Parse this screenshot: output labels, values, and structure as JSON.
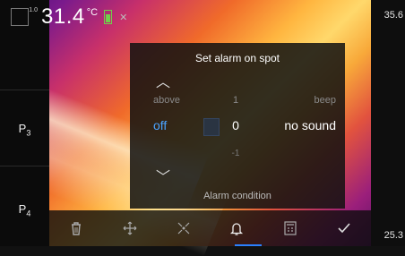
{
  "readout": {
    "mini_label": "1.0",
    "temperature": "31.4",
    "unit": "°C"
  },
  "scale": {
    "max": "35.6",
    "min": "25.3"
  },
  "sidebar": {
    "p3_label": "P",
    "p3_sub": "3",
    "p4_label": "P",
    "p4_sub": "4"
  },
  "dialog": {
    "title": "Set alarm on spot",
    "rows": {
      "above": {
        "mode": "above",
        "value": "1",
        "sound": "beep"
      },
      "current": {
        "mode": "off",
        "value": "0",
        "sound": "no sound"
      },
      "below": {
        "value": "-1"
      }
    },
    "footer": "Alarm condition"
  },
  "toolbar": {
    "icons": [
      "trash-icon",
      "move-icon",
      "center-icon",
      "alarm-bell-icon",
      "calculator-icon",
      "checkmark-icon"
    ]
  }
}
